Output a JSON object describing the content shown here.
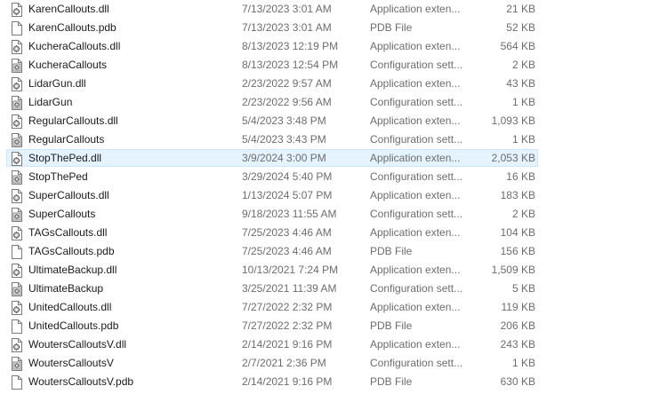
{
  "files": [
    {
      "name": "KarenCallouts.dll",
      "date": "7/13/2023 3:01 AM",
      "type": "Application exten...",
      "size": "21 KB",
      "icon": "dll-gear-icon"
    },
    {
      "name": "KarenCallouts.pdb",
      "date": "7/13/2023 3:01 AM",
      "type": "PDB File",
      "size": "52 KB",
      "icon": "blank-file-icon"
    },
    {
      "name": "KucheraCallouts.dll",
      "date": "8/13/2023 12:19 PM",
      "type": "Application exten...",
      "size": "564 KB",
      "icon": "dll-gear-icon"
    },
    {
      "name": "KucheraCallouts",
      "date": "8/13/2023 12:54 PM",
      "type": "Configuration sett...",
      "size": "2 KB",
      "icon": "config-gear-icon"
    },
    {
      "name": "LidarGun.dll",
      "date": "2/23/2022 9:57 AM",
      "type": "Application exten...",
      "size": "43 KB",
      "icon": "dll-gear-icon"
    },
    {
      "name": "LidarGun",
      "date": "2/23/2022 9:56 AM",
      "type": "Configuration sett...",
      "size": "1 KB",
      "icon": "config-gear-icon"
    },
    {
      "name": "RegularCallouts.dll",
      "date": "5/4/2023 3:48 PM",
      "type": "Application exten...",
      "size": "1,093 KB",
      "icon": "dll-gear-icon"
    },
    {
      "name": "RegularCallouts",
      "date": "5/4/2023 3:43 PM",
      "type": "Configuration sett...",
      "size": "1 KB",
      "icon": "config-gear-icon"
    },
    {
      "name": "StopThePed.dll",
      "date": "3/9/2024 3:00 PM",
      "type": "Application exten...",
      "size": "2,053 KB",
      "icon": "dll-gear-icon",
      "selected": true
    },
    {
      "name": "StopThePed",
      "date": "3/29/2024 5:40 PM",
      "type": "Configuration sett...",
      "size": "16 KB",
      "icon": "config-gear-icon"
    },
    {
      "name": "SuperCallouts.dll",
      "date": "1/13/2024 5:07 PM",
      "type": "Application exten...",
      "size": "183 KB",
      "icon": "dll-gear-icon"
    },
    {
      "name": "SuperCallouts",
      "date": "9/18/2023 11:55 AM",
      "type": "Configuration sett...",
      "size": "2 KB",
      "icon": "config-gear-icon"
    },
    {
      "name": "TAGsCallouts.dll",
      "date": "7/25/2023 4:46 AM",
      "type": "Application exten...",
      "size": "104 KB",
      "icon": "dll-gear-icon"
    },
    {
      "name": "TAGsCallouts.pdb",
      "date": "7/25/2023 4:46 AM",
      "type": "PDB File",
      "size": "156 KB",
      "icon": "blank-file-icon"
    },
    {
      "name": "UltimateBackup.dll",
      "date": "10/13/2021 7:24 PM",
      "type": "Application exten...",
      "size": "1,509 KB",
      "icon": "dll-gear-icon"
    },
    {
      "name": "UltimateBackup",
      "date": "3/25/2021 11:39 AM",
      "type": "Configuration sett...",
      "size": "5 KB",
      "icon": "config-gear-icon"
    },
    {
      "name": "UnitedCallouts.dll",
      "date": "7/27/2022 2:32 PM",
      "type": "Application exten...",
      "size": "119 KB",
      "icon": "dll-gear-icon"
    },
    {
      "name": "UnitedCallouts.pdb",
      "date": "7/27/2022 2:32 PM",
      "type": "PDB File",
      "size": "206 KB",
      "icon": "blank-file-icon"
    },
    {
      "name": "WoutersCalloutsV.dll",
      "date": "2/14/2021 9:16 PM",
      "type": "Application exten...",
      "size": "243 KB",
      "icon": "dll-gear-icon"
    },
    {
      "name": "WoutersCalloutsV",
      "date": "2/7/2021 2:36 PM",
      "type": "Configuration sett...",
      "size": "1 KB",
      "icon": "config-gear-icon"
    },
    {
      "name": "WoutersCalloutsV.pdb",
      "date": "2/14/2021 9:16 PM",
      "type": "PDB File",
      "size": "630 KB",
      "icon": "blank-file-icon"
    }
  ]
}
